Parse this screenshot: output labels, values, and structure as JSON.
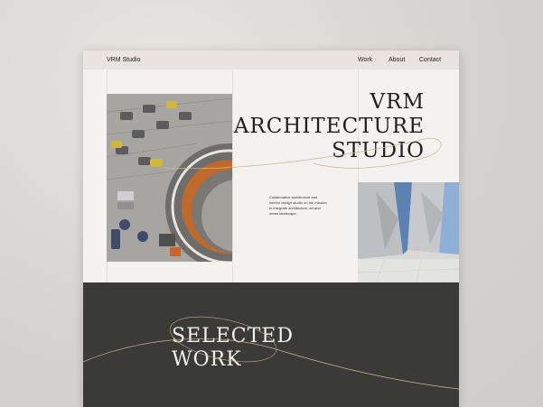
{
  "header": {
    "brand": "VRM Studio",
    "nav": [
      "Work",
      "About",
      "Contact"
    ]
  },
  "hero": {
    "title_lines": [
      "VRM",
      "ARCHITECTURE",
      "STUDIO"
    ],
    "description": "Collaborative architecture and interior design studio on the mission to integrate architecture, art and urban landscape."
  },
  "selected": {
    "title_lines": [
      "SELECTED",
      "WORK"
    ]
  },
  "colors": {
    "topbar": "#e9e4df",
    "page": "#f3f2f0",
    "dark_section": "#3a3a38",
    "accent_line": "#c8b98a"
  }
}
